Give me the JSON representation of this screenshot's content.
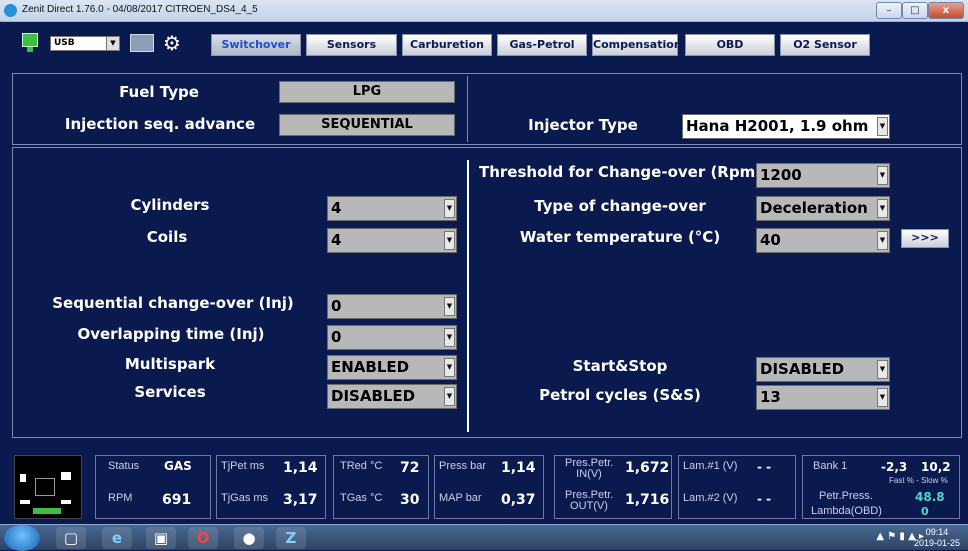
{
  "window": {
    "title": "Zenit Direct 1.76.0 - 04/08/2017    CITROEN_DS4_4_5",
    "min": "–",
    "max": "□",
    "close": "x"
  },
  "toolbar": {
    "port": "USB",
    "tabs": [
      {
        "label": "Switchover",
        "active": true
      },
      {
        "label": "Sensors",
        "active": false
      },
      {
        "label": "Carburetion",
        "active": false
      },
      {
        "label": "Gas-Petrol",
        "active": false
      },
      {
        "label": "Compensations",
        "active": false
      },
      {
        "label": "OBD",
        "active": false
      },
      {
        "label": "O2 Sensor",
        "active": false
      }
    ]
  },
  "top_panel": {
    "fuel_type_label": "Fuel Type",
    "fuel_type_value": "LPG",
    "injection_label": "Injection seq. advance",
    "injection_value": "SEQUENTIAL",
    "injector_type_label": "Injector Type",
    "injector_type_value": "Hana H2001, 1.9 ohm"
  },
  "main_panel": {
    "cylinders_label": "Cylinders",
    "cylinders_value": "4",
    "coils_label": "Coils",
    "coils_value": "4",
    "seq_changeover_label": "Sequential change-over (Inj)",
    "seq_changeover_value": "0",
    "overlapping_label": "Overlapping time (Inj)",
    "overlapping_value": "0",
    "multispark_label": "Multispark",
    "multispark_value": "ENABLED",
    "services_label": "Services",
    "services_value": "DISABLED",
    "threshold_label": "Threshold for Change-over (Rpm)",
    "threshold_value": "1200",
    "type_changeover_label": "Type of change-over",
    "type_changeover_value": "Deceleration",
    "water_temp_label": "Water temperature (°C)",
    "water_temp_value": "40",
    "more_button": ">>>",
    "start_stop_label": "Start&Stop",
    "start_stop_value": "DISABLED",
    "petrol_cycles_label": "Petrol cycles (S&S)",
    "petrol_cycles_value": "13"
  },
  "status": {
    "status_key": "Status",
    "status_val": "GAS",
    "rpm_key": "RPM",
    "rpm_val": "691",
    "tjpet_key": "TjPet ms",
    "tjpet_val": "1,14",
    "tjgas_key": "TjGas ms",
    "tjgas_val": "3,17",
    "tred_key": "TRed °C",
    "tred_val": "72",
    "tgas_key": "TGas °C",
    "tgas_val": "30",
    "press_key": "Press bar",
    "press_val": "1,14",
    "map_key": "MAP bar",
    "map_val": "0,37",
    "pres_in_key": "Pres.Petr. IN(V)",
    "pres_in_val": "1,672",
    "pres_out_key": "Pres.Petr. OUT(V)",
    "pres_out_val": "1,716",
    "lam1_key": "Lam.#1 (V)",
    "lam1_val": "- -",
    "lam2_key": "Lam.#2 (V)",
    "lam2_val": "- -",
    "bank_key": "Bank 1",
    "bank_fast": "-2,3",
    "bank_slow": "10,2",
    "fast_slow_caption": "Fast % - Slow %",
    "petr_press_key": "Petr.Press.",
    "petr_press_val": "48.8",
    "lambda_obd_key": "Lambda(OBD)",
    "lambda_obd_val": "0",
    "accent_color": "#4fd6c4"
  },
  "taskbar": {
    "clock_time": "09:14",
    "clock_date": "2019-01-25"
  }
}
